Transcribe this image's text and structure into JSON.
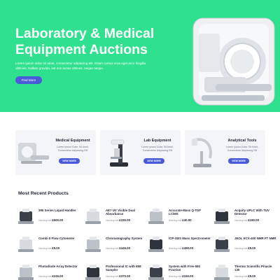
{
  "hero": {
    "title": "Laboratory & Medical Equipment Auctions",
    "text": "Lorem ipsum dolor sit amet, consectetur adipiscing elit. Etiam cursus eros eget arcu fringilla ultricies. Nullam gravida, est non luctus ultrices, neque neque.",
    "button_label": "Find More"
  },
  "categories": [
    {
      "title": "Medical Equipment",
      "desc": "Lorem Ipsum Dolor Sit Amet, Consectetur Adipiscing Elit",
      "button_label": "VIEW MORE"
    },
    {
      "title": "Lab Equipment",
      "desc": "Lorem Ipsum Dolor Sit Amet, Consectetur Adipiscing Elit",
      "button_label": "VIEW MORE"
    },
    {
      "title": "Analytical Tools",
      "desc": "Lorem Ipsum Dolor Sit Amet, Consectetur Adipiscing Elit",
      "button_label": "VIEW MORE"
    }
  ],
  "products_section": {
    "title": "Most Recent Products",
    "starting_label": "Starting bid",
    "items": [
      {
        "name": "395 Series Liquid Handler",
        "price": "£500.00"
      },
      {
        "name": "AE7 UV Visible Dual Absorbance",
        "price": "£330.00"
      },
      {
        "name": "Accurate-Mass Q-TOF LC/MS",
        "price": "£40.00"
      },
      {
        "name": "Acquity UPLC With TUV Detector",
        "price": "£180.00"
      },
      {
        "name": "Combi II Flow Cytometer",
        "price": "£5.00"
      },
      {
        "name": "Chromatography System",
        "price": "£445.00"
      },
      {
        "name": "ICP-OES Mass Spectrometer",
        "price": "£490.00"
      },
      {
        "name": "JEOL ECX-400 NMR FT NMR",
        "price": "£5.00"
      },
      {
        "name": "Photodiode Array Detector",
        "price": "£245.00"
      },
      {
        "name": "Professional IC with 858 Sampler",
        "price": "£370.00"
      },
      {
        "name": "System with Free-550 Fraction",
        "price": "£150.00"
      },
      {
        "name": "Thermo Scientific Pinacle 130",
        "price": "£5.00"
      }
    ]
  },
  "colors": {
    "hero_bg": "#2fe08f",
    "accent": "#4a5bd8"
  }
}
